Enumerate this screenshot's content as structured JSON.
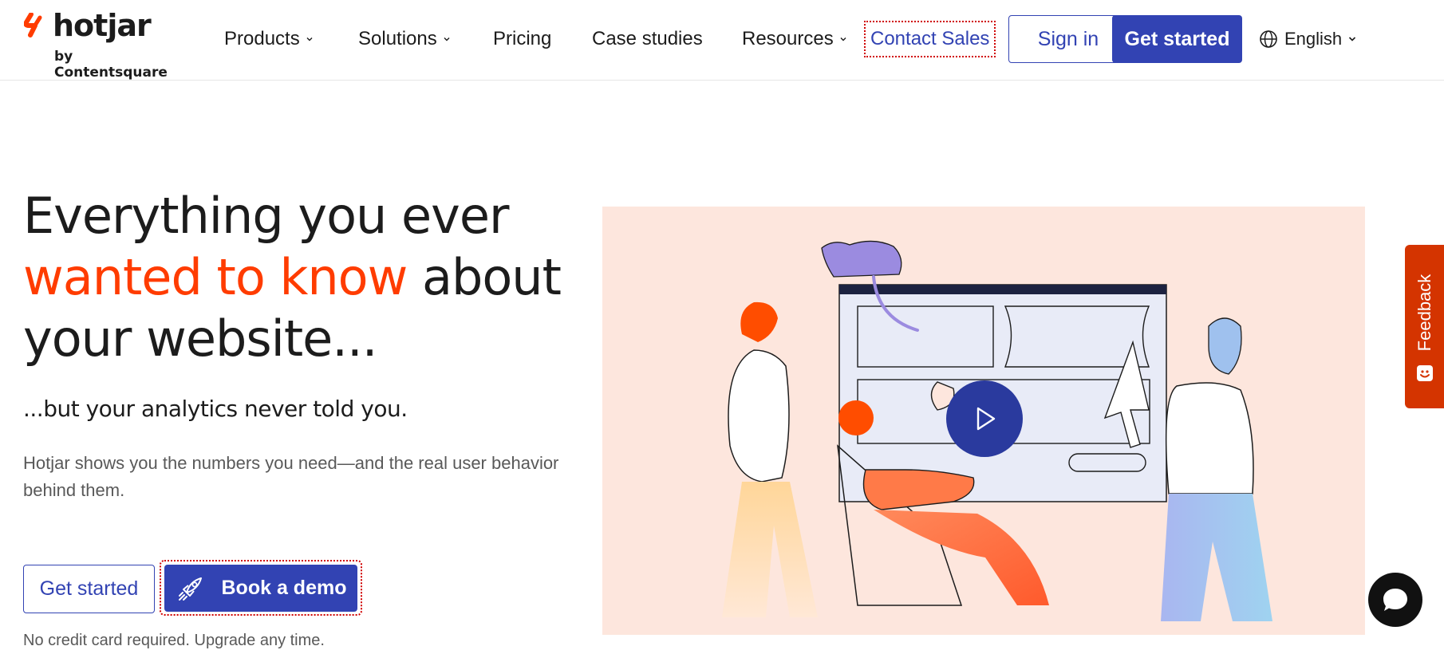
{
  "brand": {
    "name": "hotjar",
    "sub": "by Contentsquare",
    "accent_color": "#ff3c00",
    "primary_color": "#3243b3"
  },
  "nav": {
    "items": [
      {
        "label": "Products",
        "has_dropdown": true
      },
      {
        "label": "Solutions",
        "has_dropdown": true
      },
      {
        "label": "Pricing",
        "has_dropdown": false
      },
      {
        "label": "Case studies",
        "has_dropdown": false
      },
      {
        "label": "Resources",
        "has_dropdown": true
      }
    ],
    "contact_sales": "Contact Sales",
    "sign_in": "Sign in",
    "get_started": "Get started",
    "language": "English"
  },
  "hero": {
    "title_line1": "Everything you ever",
    "title_accent": "wanted to know",
    "title_line2_rest": " about",
    "title_line3": "your website...",
    "subtitle": "...but your analytics never told you.",
    "description": "Hotjar shows you the numbers you need—and the real user behavior behind them.",
    "primary_cta": "Get started",
    "secondary_cta": "Book a demo",
    "note": "No credit card required. Upgrade any time."
  },
  "widgets": {
    "feedback_label": "Feedback",
    "feedback_color": "#d43400"
  },
  "icons": {
    "globe": "globe-icon",
    "chevron": "chevron-down-icon",
    "rocket": "rocket-icon",
    "play": "play-icon",
    "chat": "chat-bubble-icon"
  }
}
